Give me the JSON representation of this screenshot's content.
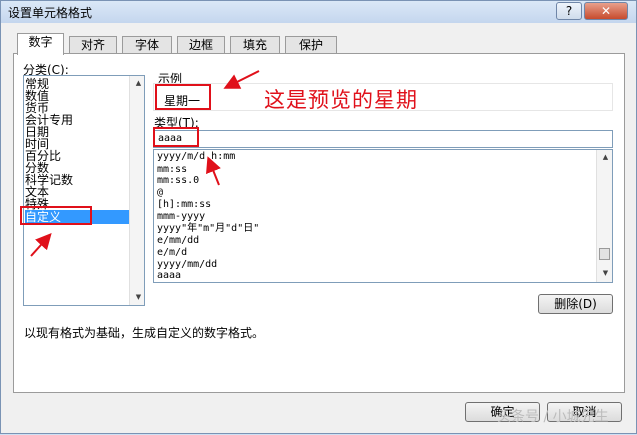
{
  "window": {
    "title": "设置单元格格式",
    "help_label": "?",
    "close_label": "✕"
  },
  "tabs": [
    {
      "label": "数字",
      "active": true
    },
    {
      "label": "对齐",
      "active": false
    },
    {
      "label": "字体",
      "active": false
    },
    {
      "label": "边框",
      "active": false
    },
    {
      "label": "填充",
      "active": false
    },
    {
      "label": "保护",
      "active": false
    }
  ],
  "category": {
    "label": "分类(C):",
    "items": [
      "常规",
      "数值",
      "货币",
      "会计专用",
      "日期",
      "时间",
      "百分比",
      "分数",
      "科学记数",
      "文本",
      "特殊",
      "自定义"
    ],
    "selected": "自定义"
  },
  "sample": {
    "label": "示例",
    "value": "星期一"
  },
  "type": {
    "label": "类型(T):",
    "value": "aaaa",
    "list": [
      "yyyy/m/d h:mm",
      "mm:ss",
      "mm:ss.0",
      "@",
      "[h]:mm:ss",
      "mmm-yyyy",
      "yyyy\"年\"m\"月\"d\"日\"",
      "e/mm/dd",
      "e/m/d",
      "yyyy/mm/dd",
      "aaaa"
    ]
  },
  "buttons": {
    "delete": "删除(D)",
    "ok": "确定",
    "cancel": "取消"
  },
  "description": "以现有格式为基础，生成自定义的数字格式。",
  "annotation": {
    "text": "这是预览的星期",
    "color": "#e0101a"
  },
  "watermark": "头条号 / 小城先生",
  "colors": {
    "selection": "#3399ff",
    "annotation": "#e0101a"
  }
}
